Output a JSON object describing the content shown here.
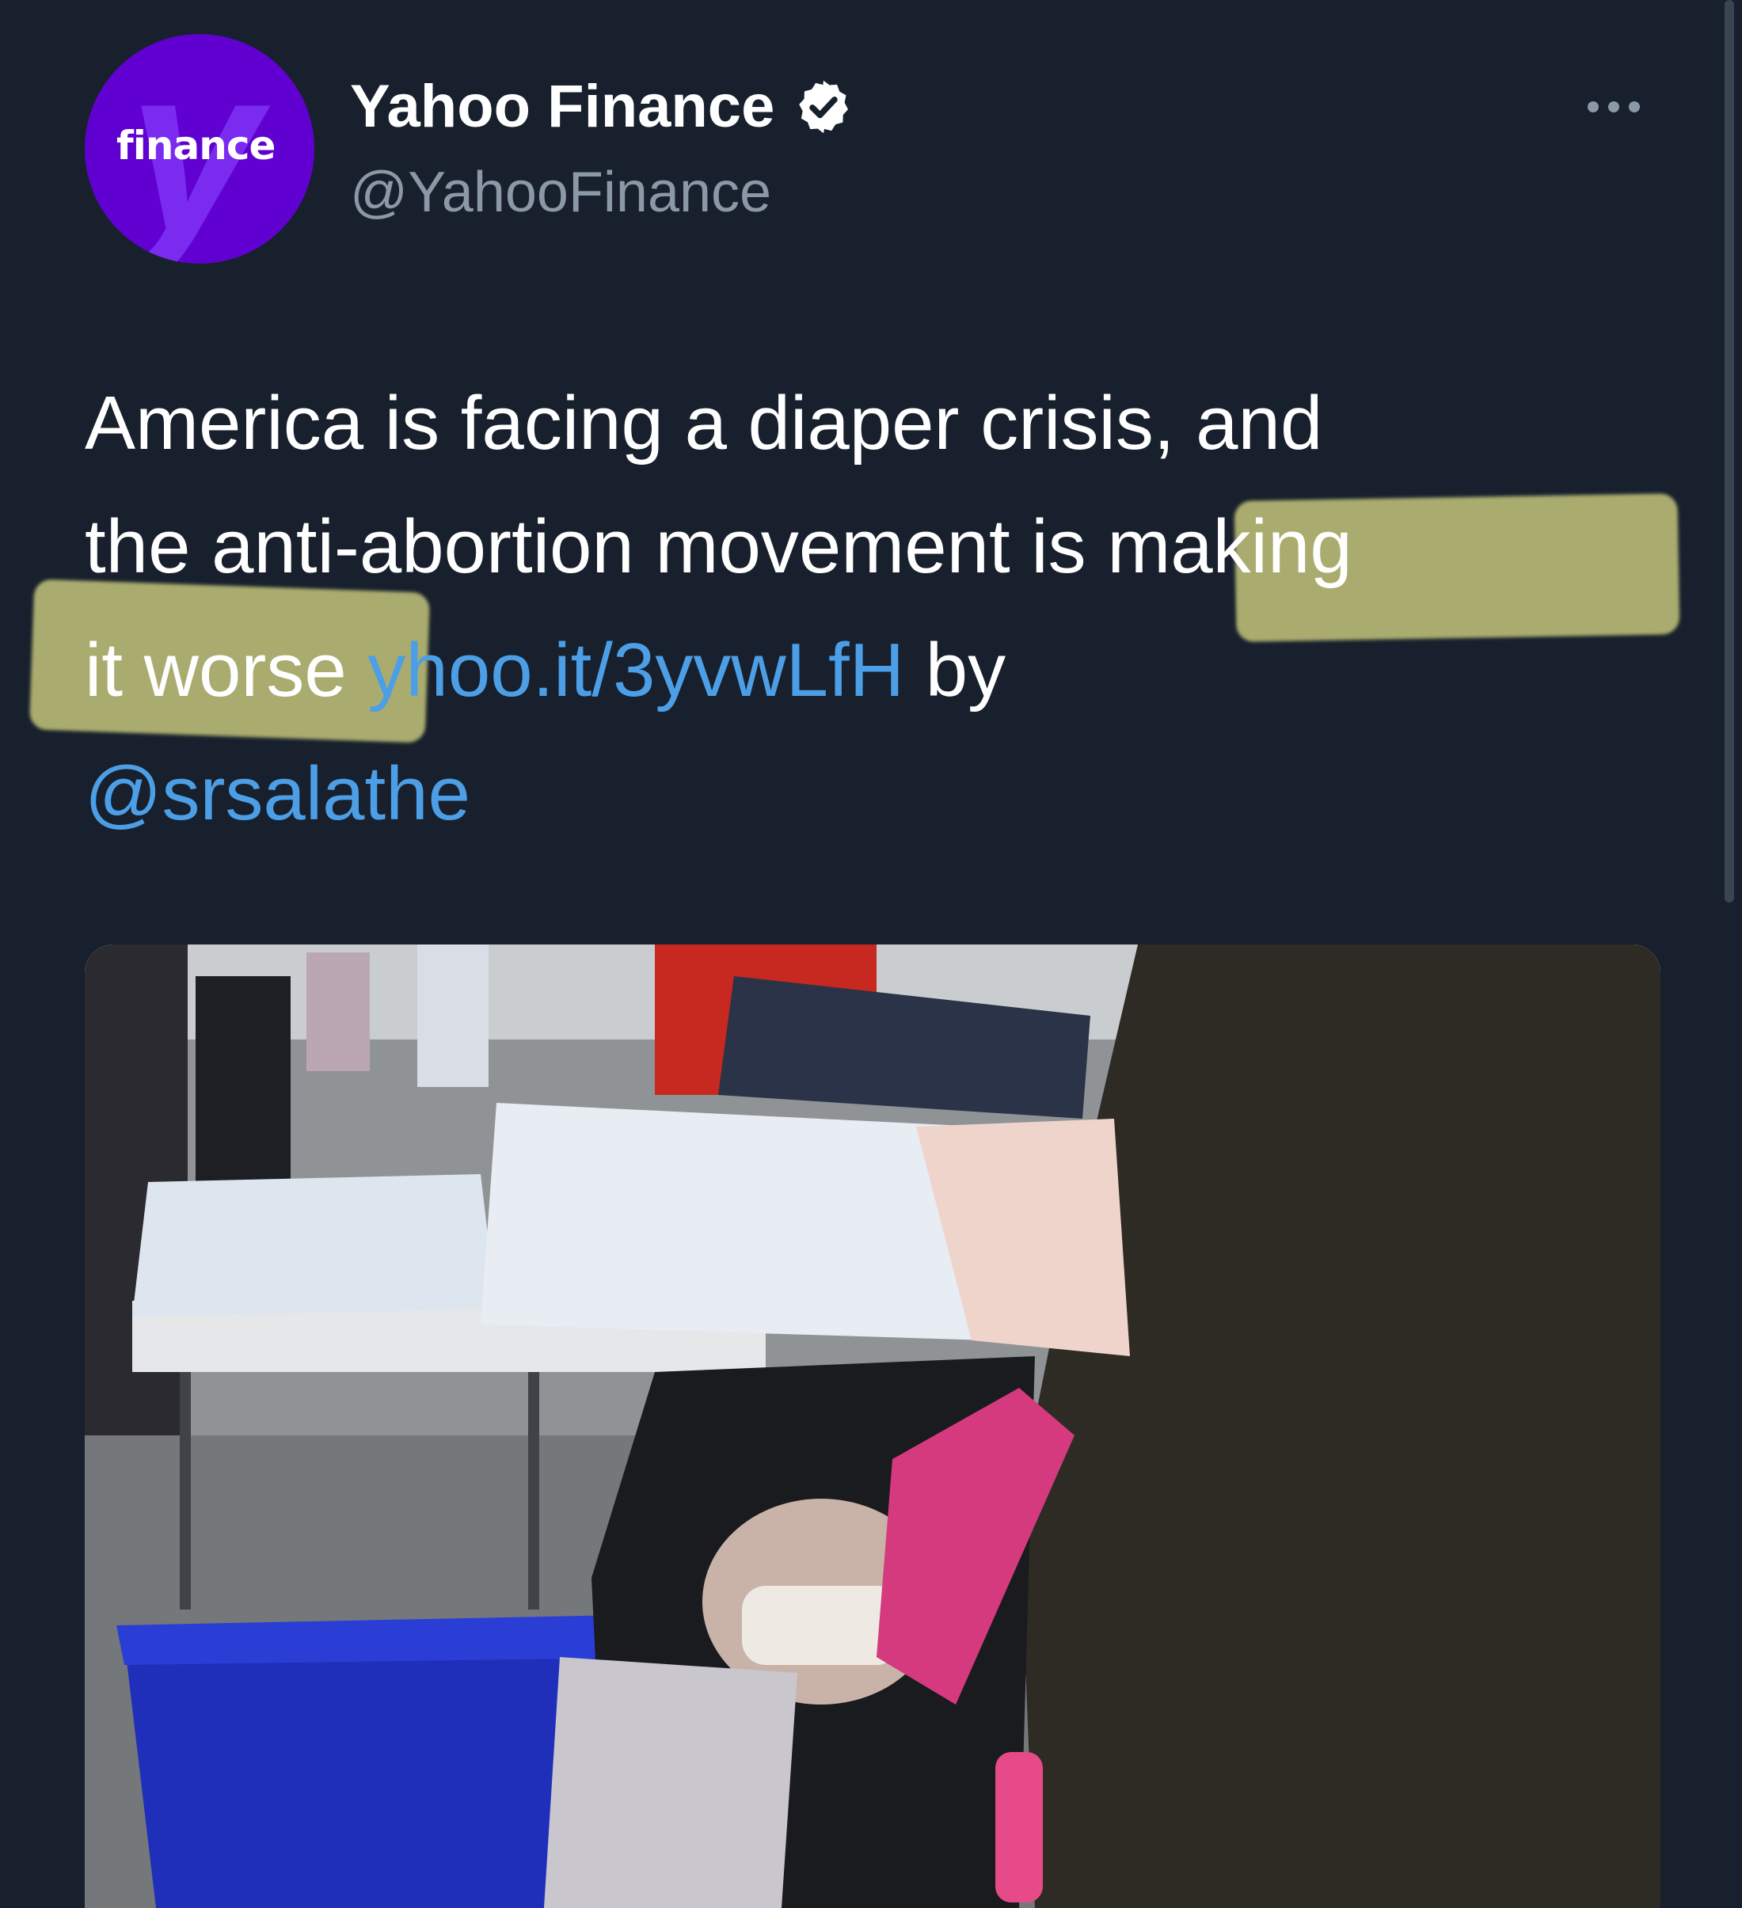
{
  "account": {
    "display_name": "Yahoo Finance",
    "handle": "@YahooFinance",
    "avatar_text": "finance",
    "avatar_letter": "y",
    "verified": true
  },
  "tweet": {
    "line1": "America is facing a diaper crisis, and",
    "line2_a": "the anti-abortion movement ",
    "line2_b": "is making",
    "line3_a": "it worse",
    "line3_link": "yhoo.it/3yvwLfH",
    "line3_b": " by",
    "line4_mention": "@srsalathe"
  },
  "colors": {
    "background": "#17202c",
    "link": "#4c9fe6",
    "secondary_text": "#8b98a5",
    "highlight": "#d4d482",
    "brand_purple": "#6001d2"
  },
  "icons": {
    "verified": "verified-badge-icon",
    "more": "more-options-icon"
  }
}
